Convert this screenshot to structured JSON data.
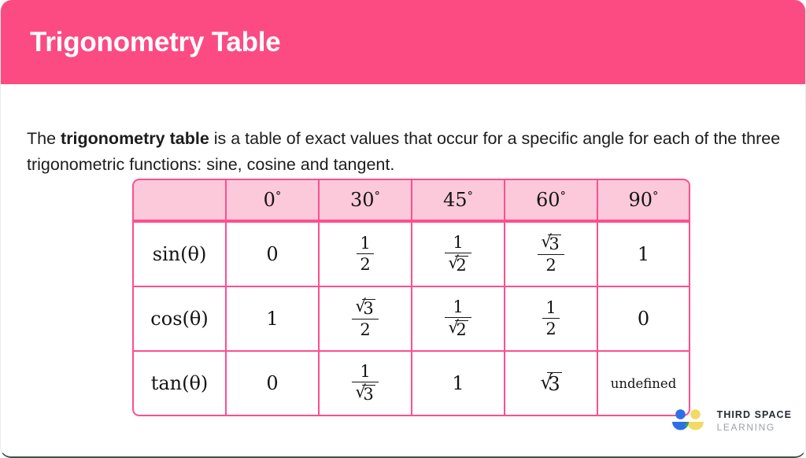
{
  "page": {
    "background": "#ffffff",
    "border_bottom_color": "#3c5244"
  },
  "header": {
    "title": "Trigonometry Table",
    "background": "#fb4b82",
    "text_color": "#ffffff"
  },
  "intro": {
    "part1": "The ",
    "bold": "trigonometry table",
    "part2": " is a table of exact values that occur for a specific angle for each of the three trigonometric functions: sine, cosine and tangent."
  },
  "table": {
    "header_background": "#fbc9da",
    "border_color": "#fd4f8f",
    "columns": [
      "",
      "0°",
      "30°",
      "45°",
      "60°",
      "90°"
    ],
    "column_angles": [
      "0",
      "30",
      "45",
      "60",
      "90"
    ],
    "degree_symbol": "°",
    "rows": [
      {
        "label": "sin(θ)",
        "values": [
          "0",
          "1/2",
          "1/√2",
          "√3/2",
          "1"
        ]
      },
      {
        "label": "cos(θ)",
        "values": [
          "1",
          "√3/2",
          "1/√2",
          "1/2",
          "0"
        ]
      },
      {
        "label": "tan(θ)",
        "values": [
          "0",
          "1/√3",
          "1",
          "√3",
          "undefined"
        ]
      }
    ],
    "cells": {
      "sin_label": "sin(θ)",
      "cos_label": "cos(θ)",
      "tan_label": "tan(θ)",
      "zero": "0",
      "one": "1",
      "two": "2",
      "three": "3",
      "undefined": "undefined"
    }
  },
  "logo": {
    "line1": "THIRD SPACE",
    "line2": "LEARNING",
    "colors": {
      "blue": "#2f6fe4",
      "blue_dot": "#2f6fe4",
      "yellow": "#f2da63",
      "green": "#34a853"
    }
  }
}
